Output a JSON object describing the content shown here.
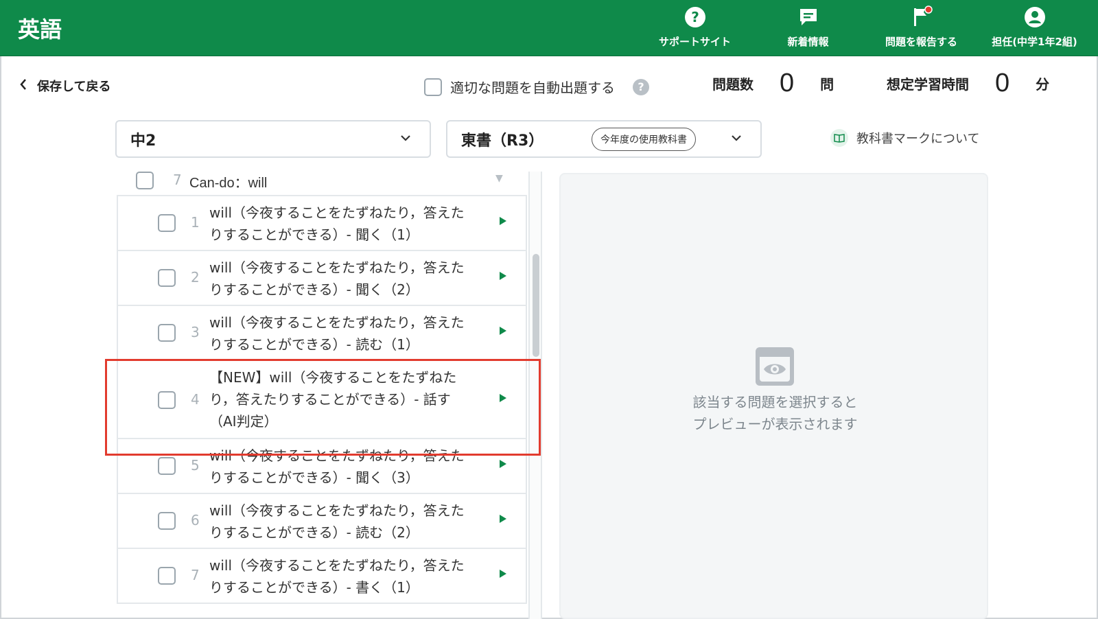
{
  "header": {
    "title": "英語",
    "nav": [
      {
        "label": "サポートサイト",
        "icon": "help-circle-icon"
      },
      {
        "label": "新着情報",
        "icon": "message-icon"
      },
      {
        "label": "問題を報告する",
        "icon": "flag-icon"
      },
      {
        "label": "担任(中学1年2組)",
        "icon": "user-icon"
      }
    ]
  },
  "toolbar": {
    "back_label": "保存して戻る",
    "auto_label": "適切な問題を自動出題する",
    "count_label": "問題数",
    "count_value": "0",
    "count_unit": "問",
    "time_label": "想定学習時間",
    "time_value": "0",
    "time_unit": "分"
  },
  "filters": {
    "grade": "中2",
    "textbook": "東書（R3）",
    "textbook_badge": "今年度の使用教科書",
    "mark_note": "教科書マークについて"
  },
  "list": {
    "group": {
      "number": "7",
      "title": "Can-do：will"
    },
    "items": [
      {
        "number": "1",
        "text": "will（今夜することをたずねたり，答えたりすることができる）- 聞く（1）"
      },
      {
        "number": "2",
        "text": "will（今夜することをたずねたり，答えたりすることができる）- 聞く（2）"
      },
      {
        "number": "3",
        "text": "will（今夜することをたずねたり，答えたりすることができる）- 読む（1）"
      },
      {
        "number": "4",
        "text": "【NEW】will（今夜することをたずねたり，答えたりすることができる）- 話す（AI判定）"
      },
      {
        "number": "5",
        "text": "will（今夜することをたずねたり，答えたりすることができる）- 聞く（3）"
      },
      {
        "number": "6",
        "text": "will（今夜することをたずねたり，答えたりすることができる）- 読む（2）"
      },
      {
        "number": "7",
        "text": "will（今夜することをたずねたり，答えたりすることができる）- 書く（1）"
      }
    ]
  },
  "preview": {
    "line1": "該当する問題を選択すると",
    "line2": "プレビューが表示されます"
  },
  "colors": {
    "brand": "#0f8a4a",
    "highlight": "#e23b2e"
  }
}
